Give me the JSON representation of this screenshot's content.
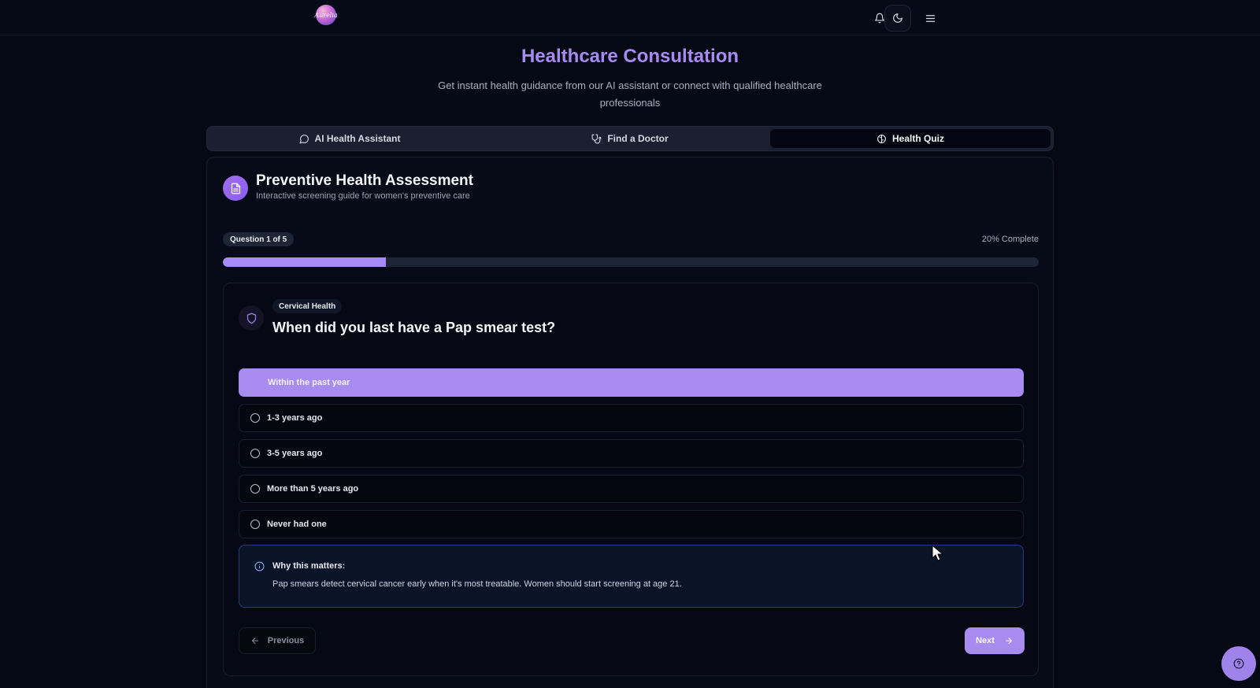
{
  "header": {
    "logo_text": "Aurelia",
    "icons": [
      "bell-icon",
      "moon-icon",
      "menu-icon"
    ]
  },
  "page": {
    "title": "Healthcare Consultation",
    "subtitle": "Get instant health guidance from our AI assistant or connect with qualified healthcare professionals"
  },
  "tabs": [
    {
      "label": "AI Health Assistant",
      "icon": "chat-icon",
      "active": false
    },
    {
      "label": "Find a Doctor",
      "icon": "stethoscope-icon",
      "active": false
    },
    {
      "label": "Health Quiz",
      "icon": "brain-icon",
      "active": true
    }
  ],
  "assessment": {
    "title": "Preventive Health Assessment",
    "subtitle": "Interactive screening guide for women's preventive care",
    "question_counter": "Question 1 of 5",
    "percent_complete": "20% Complete",
    "progress": 0.2
  },
  "question": {
    "category": "Cervical Health",
    "text": "When did you last have a Pap smear test?",
    "options": [
      {
        "label": "Within the past year",
        "selected": true
      },
      {
        "label": "1-3 years ago",
        "selected": false
      },
      {
        "label": "3-5 years ago",
        "selected": false
      },
      {
        "label": "More than 5 years ago",
        "selected": false
      },
      {
        "label": "Never had one",
        "selected": false
      }
    ],
    "info_title": "Why this matters:",
    "info_text": "Pap smears detect cervical cancer early when it's most treatable. Women should start screening at age 21."
  },
  "nav": {
    "previous_label": "Previous",
    "next_label": "Next"
  },
  "colors": {
    "accent": "#a78bfa",
    "title": "#a98af0",
    "background": "#050914",
    "info_border": "#243c7c"
  }
}
